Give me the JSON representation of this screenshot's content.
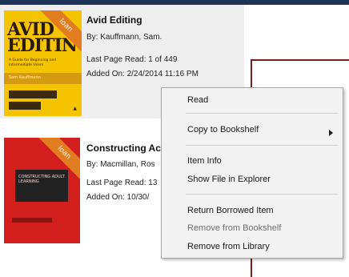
{
  "books": [
    {
      "title": "Avid Editing",
      "by": "By:  Kauffmann, Sam.",
      "last_page": "Last Page Read:  1 of 449",
      "added": "Added On:  2/24/2014 11:16 PM",
      "badge": "loan",
      "cover": {
        "title_line1": "AVID",
        "title_line2": "EDITING",
        "subtitle": "A Guide for Beginning and Intermediate Users",
        "author": "Sam Kauffmann"
      }
    },
    {
      "title": "Constructing Ac",
      "by": "By:  Macmillan, Ros",
      "last_page": "Last Page Read:  13",
      "added": "Added On:  10/30/",
      "badge": "loan",
      "cover": {
        "text": "CONSTRUCTING ADULT LEARNING"
      }
    }
  ],
  "context_menu": {
    "items": [
      {
        "label": "Read",
        "enabled": true
      },
      {
        "label": "Copy to Bookshelf",
        "enabled": true,
        "submenu": true
      },
      {
        "label": "Item Info",
        "enabled": true
      },
      {
        "label": "Show File in Explorer",
        "enabled": true
      },
      {
        "label": "Return Borrowed Item",
        "enabled": true
      },
      {
        "label": "Remove from Bookshelf",
        "enabled": false
      },
      {
        "label": "Remove from Library",
        "enabled": true
      }
    ]
  },
  "colors": {
    "top_bar": "#1d3357",
    "selection_bg": "#eeeeee",
    "loan_ribbon": "#e17c1f",
    "menu_bg": "#f2f2f2"
  }
}
